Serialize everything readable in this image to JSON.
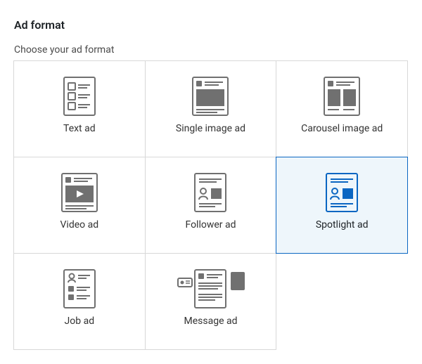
{
  "header": {
    "title": "Ad format",
    "subtitle": "Choose your ad format"
  },
  "formats": [
    {
      "id": "text",
      "label": "Text ad",
      "selected": false
    },
    {
      "id": "single",
      "label": "Single image ad",
      "selected": false
    },
    {
      "id": "carousel",
      "label": "Carousel image ad",
      "selected": false
    },
    {
      "id": "video",
      "label": "Video ad",
      "selected": false
    },
    {
      "id": "follower",
      "label": "Follower ad",
      "selected": false
    },
    {
      "id": "spotlight",
      "label": "Spotlight ad",
      "selected": true
    },
    {
      "id": "job",
      "label": "Job ad",
      "selected": false
    },
    {
      "id": "message",
      "label": "Message ad",
      "selected": false
    }
  ],
  "colors": {
    "border": "#d8d8d8",
    "selected_border": "#0a66c2",
    "selected_bg": "#eef6fb",
    "icon_stroke": "#707070",
    "icon_fill": "#707070",
    "icon_selected": "#0a66c2"
  }
}
